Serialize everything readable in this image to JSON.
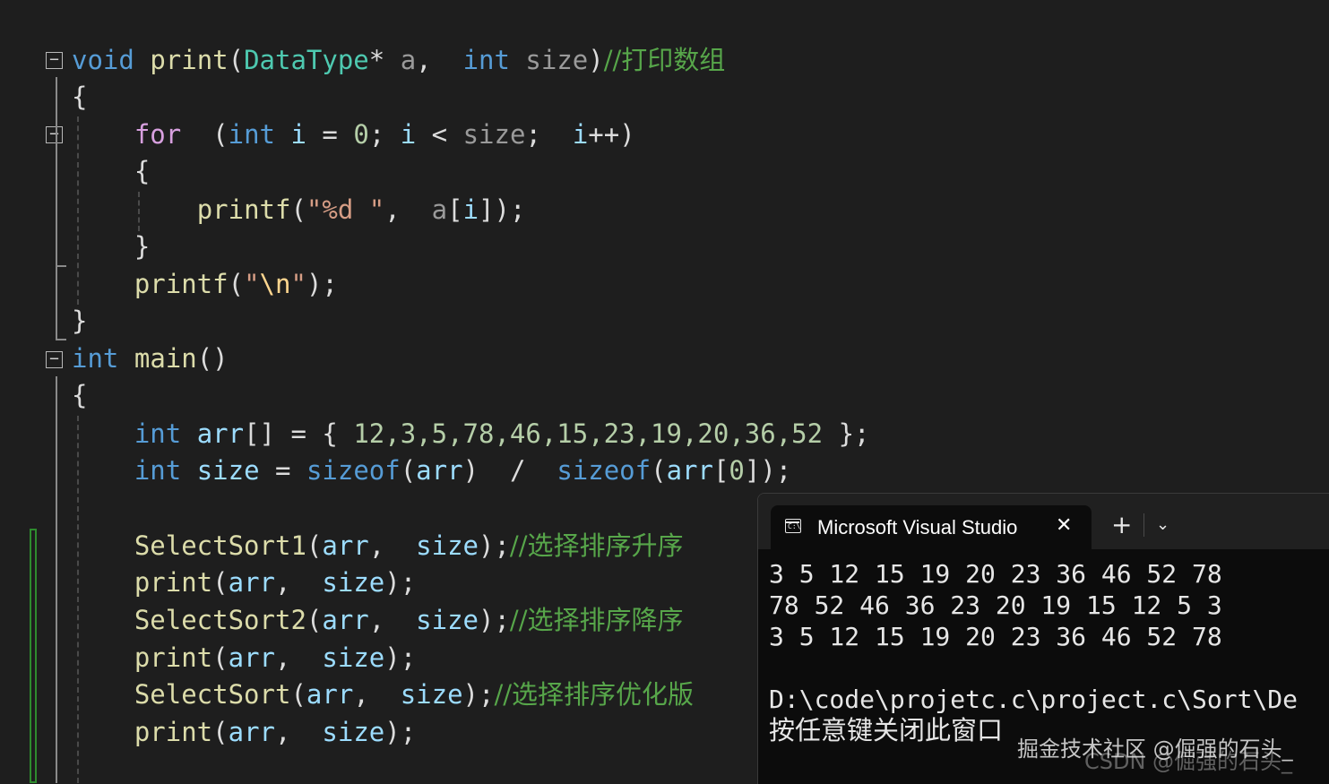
{
  "editor": {
    "lines": [
      [
        {
          "t": "void",
          "c": "kw"
        },
        {
          "t": " ",
          "c": "pl"
        },
        {
          "t": "print",
          "c": "fn"
        },
        {
          "t": "(",
          "c": "pl"
        },
        {
          "t": "DataType",
          "c": "ty"
        },
        {
          "t": "* ",
          "c": "pl"
        },
        {
          "t": "a",
          "c": "par"
        },
        {
          "t": ",  ",
          "c": "pl"
        },
        {
          "t": "int",
          "c": "kw"
        },
        {
          "t": " ",
          "c": "pl"
        },
        {
          "t": "size",
          "c": "par"
        },
        {
          "t": ")",
          "c": "pl"
        },
        {
          "t": "//打印数组",
          "c": "cm"
        }
      ],
      [
        {
          "t": "{",
          "c": "pl"
        }
      ],
      [
        {
          "t": "    ",
          "c": "pl"
        },
        {
          "t": "for",
          "c": "kw2"
        },
        {
          "t": "  (",
          "c": "pl"
        },
        {
          "t": "int",
          "c": "kw"
        },
        {
          "t": " ",
          "c": "pl"
        },
        {
          "t": "i",
          "c": "var"
        },
        {
          "t": " = ",
          "c": "pl"
        },
        {
          "t": "0",
          "c": "num"
        },
        {
          "t": "; ",
          "c": "pl"
        },
        {
          "t": "i",
          "c": "var"
        },
        {
          "t": " < ",
          "c": "pl"
        },
        {
          "t": "size",
          "c": "par"
        },
        {
          "t": ";  ",
          "c": "pl"
        },
        {
          "t": "i",
          "c": "var"
        },
        {
          "t": "++)",
          "c": "pl"
        }
      ],
      [
        {
          "t": "    {",
          "c": "pl"
        }
      ],
      [
        {
          "t": "        ",
          "c": "pl"
        },
        {
          "t": "printf",
          "c": "fn"
        },
        {
          "t": "(",
          "c": "pl"
        },
        {
          "t": "\"%d \"",
          "c": "str"
        },
        {
          "t": ",  ",
          "c": "pl"
        },
        {
          "t": "a",
          "c": "par"
        },
        {
          "t": "[",
          "c": "pl"
        },
        {
          "t": "i",
          "c": "var"
        },
        {
          "t": "]);",
          "c": "pl"
        }
      ],
      [
        {
          "t": "    }",
          "c": "pl"
        }
      ],
      [
        {
          "t": "    ",
          "c": "pl"
        },
        {
          "t": "printf",
          "c": "fn"
        },
        {
          "t": "(",
          "c": "pl"
        },
        {
          "t": "\"",
          "c": "str"
        },
        {
          "t": "\\n",
          "c": "esc"
        },
        {
          "t": "\"",
          "c": "str"
        },
        {
          "t": ");",
          "c": "pl"
        }
      ],
      [
        {
          "t": "}",
          "c": "pl"
        }
      ],
      [
        {
          "t": "int",
          "c": "kw"
        },
        {
          "t": " ",
          "c": "pl"
        },
        {
          "t": "main",
          "c": "fn"
        },
        {
          "t": "()",
          "c": "pl"
        }
      ],
      [
        {
          "t": "{",
          "c": "pl"
        }
      ],
      [
        {
          "t": "    ",
          "c": "pl"
        },
        {
          "t": "int",
          "c": "kw"
        },
        {
          "t": " ",
          "c": "pl"
        },
        {
          "t": "arr",
          "c": "var"
        },
        {
          "t": "[] = { ",
          "c": "pl"
        },
        {
          "t": "12,3,5,78,46,15,23,19,20,36,52",
          "c": "num"
        },
        {
          "t": " };",
          "c": "pl"
        }
      ],
      [
        {
          "t": "    ",
          "c": "pl"
        },
        {
          "t": "int",
          "c": "kw"
        },
        {
          "t": " ",
          "c": "pl"
        },
        {
          "t": "size",
          "c": "var"
        },
        {
          "t": " = ",
          "c": "pl"
        },
        {
          "t": "sizeof",
          "c": "kw"
        },
        {
          "t": "(",
          "c": "pl"
        },
        {
          "t": "arr",
          "c": "var"
        },
        {
          "t": ")  /  ",
          "c": "pl"
        },
        {
          "t": "sizeof",
          "c": "kw"
        },
        {
          "t": "(",
          "c": "pl"
        },
        {
          "t": "arr",
          "c": "var"
        },
        {
          "t": "[",
          "c": "pl"
        },
        {
          "t": "0",
          "c": "num"
        },
        {
          "t": "]);",
          "c": "pl"
        }
      ],
      [],
      [
        {
          "t": "    ",
          "c": "pl"
        },
        {
          "t": "SelectSort1",
          "c": "fn"
        },
        {
          "t": "(",
          "c": "pl"
        },
        {
          "t": "arr",
          "c": "var"
        },
        {
          "t": ",  ",
          "c": "pl"
        },
        {
          "t": "size",
          "c": "var"
        },
        {
          "t": ");",
          "c": "pl"
        },
        {
          "t": "//选择排序升序",
          "c": "cm"
        }
      ],
      [
        {
          "t": "    ",
          "c": "pl"
        },
        {
          "t": "print",
          "c": "fn"
        },
        {
          "t": "(",
          "c": "pl"
        },
        {
          "t": "arr",
          "c": "var"
        },
        {
          "t": ",  ",
          "c": "pl"
        },
        {
          "t": "size",
          "c": "var"
        },
        {
          "t": ");",
          "c": "pl"
        }
      ],
      [
        {
          "t": "    ",
          "c": "pl"
        },
        {
          "t": "SelectSort2",
          "c": "fn"
        },
        {
          "t": "(",
          "c": "pl"
        },
        {
          "t": "arr",
          "c": "var"
        },
        {
          "t": ",  ",
          "c": "pl"
        },
        {
          "t": "size",
          "c": "var"
        },
        {
          "t": ");",
          "c": "pl"
        },
        {
          "t": "//选择排序降序",
          "c": "cm"
        }
      ],
      [
        {
          "t": "    ",
          "c": "pl"
        },
        {
          "t": "print",
          "c": "fn"
        },
        {
          "t": "(",
          "c": "pl"
        },
        {
          "t": "arr",
          "c": "var"
        },
        {
          "t": ",  ",
          "c": "pl"
        },
        {
          "t": "size",
          "c": "var"
        },
        {
          "t": ");",
          "c": "pl"
        }
      ],
      [
        {
          "t": "    ",
          "c": "pl"
        },
        {
          "t": "SelectSort",
          "c": "fn"
        },
        {
          "t": "(",
          "c": "pl"
        },
        {
          "t": "arr",
          "c": "var"
        },
        {
          "t": ",  ",
          "c": "pl"
        },
        {
          "t": "size",
          "c": "var"
        },
        {
          "t": ");",
          "c": "pl"
        },
        {
          "t": "//选择排序优化版",
          "c": "cm"
        }
      ],
      [
        {
          "t": "    ",
          "c": "pl"
        },
        {
          "t": "print",
          "c": "fn"
        },
        {
          "t": "(",
          "c": "pl"
        },
        {
          "t": "arr",
          "c": "var"
        },
        {
          "t": ",  ",
          "c": "pl"
        },
        {
          "t": "size",
          "c": "var"
        },
        {
          "t": ");",
          "c": "pl"
        }
      ]
    ],
    "fold_glyph": "−"
  },
  "terminal": {
    "tab_title": "Microsoft Visual Studio",
    "tab_icon": "terminal-icon",
    "close_glyph": "✕",
    "new_tab_glyph": "+",
    "dropdown_glyph": "⌄",
    "output": [
      "3 5 12 15 19 20 23 36 46 52 78",
      "78 52 46 36 23 20 19 15 12 5 3",
      "3 5 12 15 19 20 23 36 46 52 78",
      "",
      "D:\\code\\projetc.c\\project.c\\Sort\\De",
      "按任意键关闭此窗口"
    ]
  },
  "watermark": {
    "primary": "掘金技术社区 @倔强的石头_",
    "secondary": "CSDN @倔强的石头_"
  }
}
